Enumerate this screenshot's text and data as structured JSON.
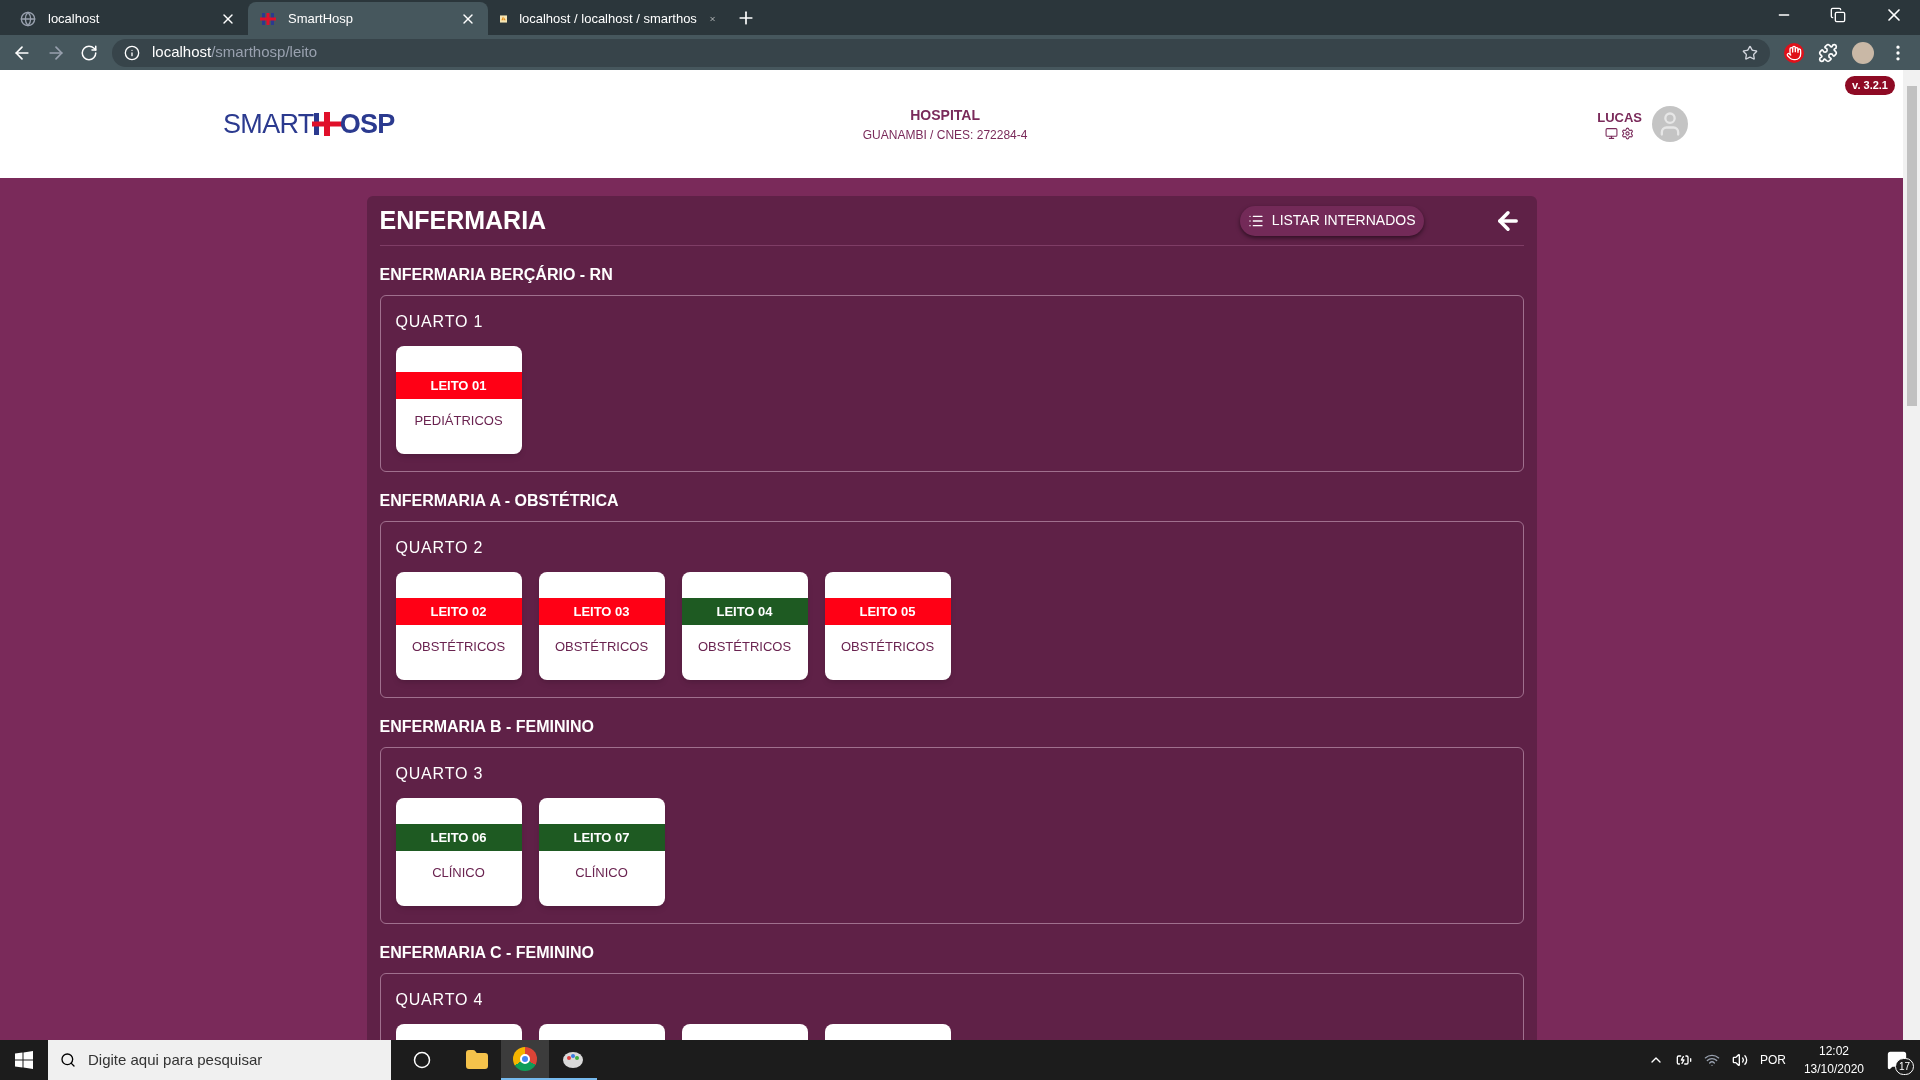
{
  "browser": {
    "tabs": [
      {
        "title": "localhost",
        "selected": false,
        "kind": "globe"
      },
      {
        "title": "SmartHosp",
        "selected": true,
        "kind": "logo"
      },
      {
        "title": "localhost / localhost / smarthos",
        "selected": false,
        "kind": "pma"
      }
    ],
    "url_host": "localhost",
    "url_path": "/smarthosp/leito"
  },
  "header": {
    "logo_left": "SMART",
    "logo_right": "OSP",
    "hospital": "HOSPITAL",
    "location": "GUANAMBI / CNES: 272284-4",
    "user": "LUCAS",
    "version": "v. 3.2.1"
  },
  "page": {
    "title": "ENFERMARIA",
    "list_button": "LISTAR INTERNADOS",
    "wards": [
      {
        "name": "ENFERMARIA BERÇÁRIO - RN",
        "rooms": [
          {
            "name": "QUARTO 1",
            "beds": [
              {
                "label": "LEITO 01",
                "type": "PEDIÁTRICOS",
                "occupied": true
              }
            ]
          }
        ]
      },
      {
        "name": "ENFERMARIA A - OBSTÉTRICA",
        "rooms": [
          {
            "name": "QUARTO 2",
            "beds": [
              {
                "label": "LEITO 02",
                "type": "OBSTÉTRICOS",
                "occupied": true
              },
              {
                "label": "LEITO 03",
                "type": "OBSTÉTRICOS",
                "occupied": true
              },
              {
                "label": "LEITO 04",
                "type": "OBSTÉTRICOS",
                "occupied": false
              },
              {
                "label": "LEITO 05",
                "type": "OBSTÉTRICOS",
                "occupied": true
              }
            ]
          }
        ]
      },
      {
        "name": "ENFERMARIA B - FEMININO",
        "rooms": [
          {
            "name": "QUARTO 3",
            "beds": [
              {
                "label": "LEITO 06",
                "type": "CLÍNICO",
                "occupied": false
              },
              {
                "label": "LEITO 07",
                "type": "CLÍNICO",
                "occupied": false
              }
            ]
          }
        ]
      },
      {
        "name": "ENFERMARIA C - FEMININO",
        "rooms": [
          {
            "name": "QUARTO 4",
            "beds": [
              {
                "cut_off": true
              },
              {
                "cut_off": true
              },
              {
                "cut_off": true
              },
              {
                "cut_off": true
              }
            ]
          }
        ]
      }
    ]
  },
  "taskbar": {
    "search_placeholder": "Digite aqui para pesquisar",
    "language": "POR",
    "time": "12:02",
    "date": "13/10/2020",
    "notifications": "17"
  }
}
